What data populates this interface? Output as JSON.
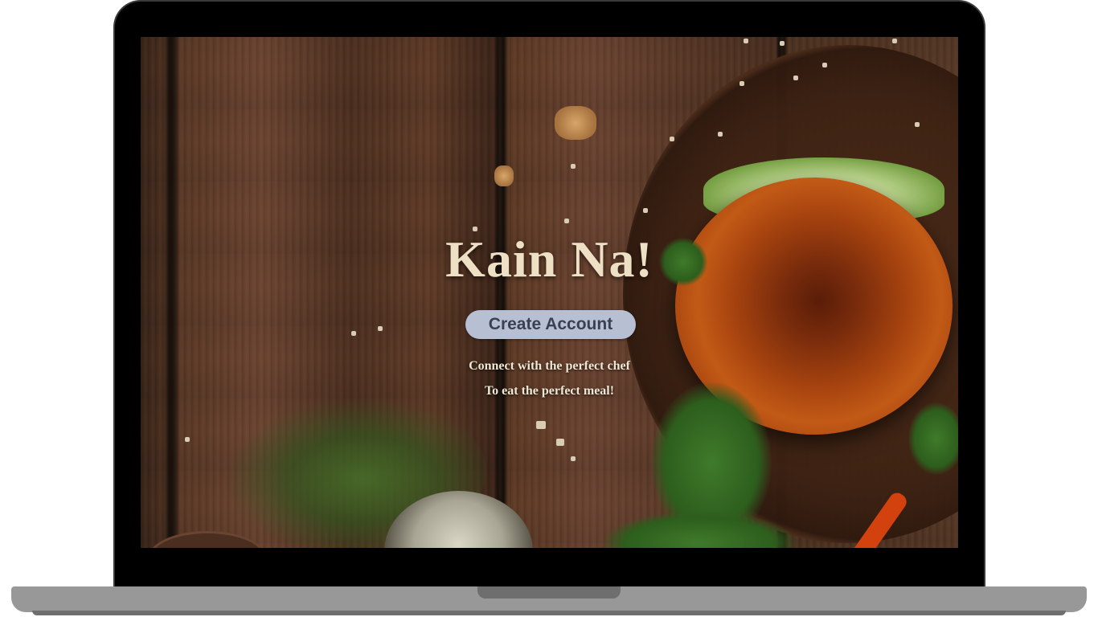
{
  "hero": {
    "title": "Kain Na!",
    "cta_label": "Create Account",
    "tagline_line1": "Connect with the perfect chef",
    "tagline_line2": "To eat the perfect meal!"
  },
  "colors": {
    "title": "#eee0c4",
    "cta_background": "#b7c0d3",
    "cta_text": "#3b3f52",
    "laptop_bezel": "#000000",
    "laptop_base": "#989898"
  },
  "icons": {
    "background_image": "burger-on-wood-table-photo"
  }
}
